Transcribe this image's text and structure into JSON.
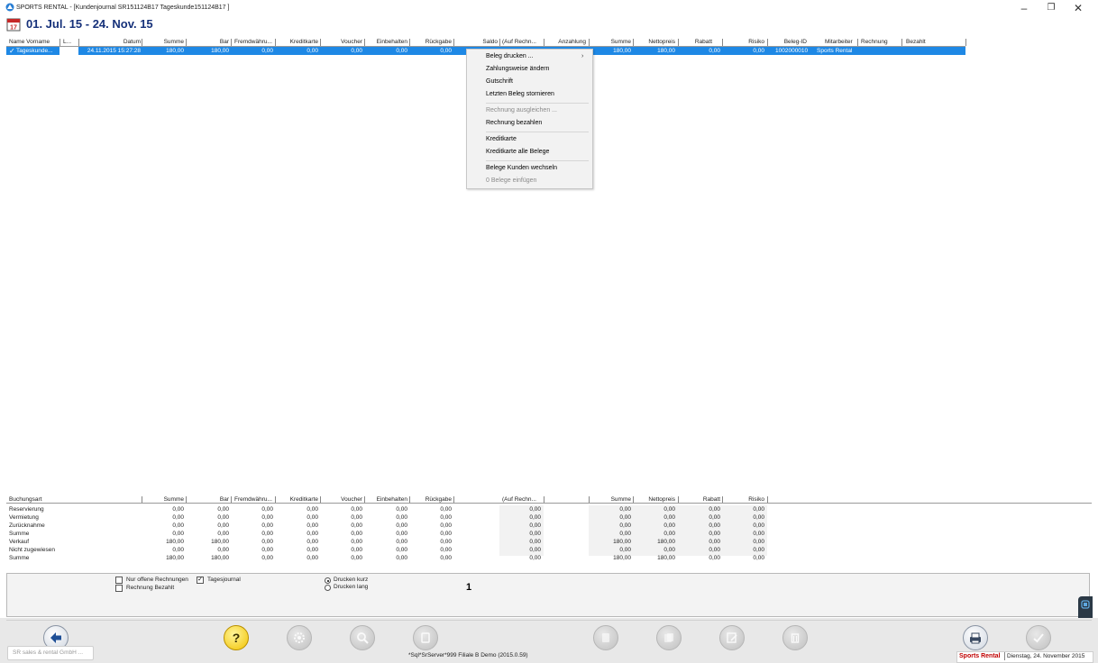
{
  "window": {
    "title": "SPORTS RENTAL - [Kundenjournal  SR151124B17 Tageskunde151124B17 ]",
    "min_glyph": "–",
    "max_glyph": "❐",
    "close_glyph": "✕"
  },
  "header": {
    "date_range": "01. Jul. 15 - 24. Nov. 15"
  },
  "top_table": {
    "columns": [
      "Name Vorname",
      "L...",
      "Datum",
      "Summe",
      "Bar",
      "Fremdwähru...",
      "Kreditkarte",
      "Voucher",
      "Einbehalten",
      "Rückgabe",
      "Saldo",
      "(Auf Rechn...",
      "Anzahlung",
      "Summe",
      "Nettopreis",
      "Rabatt",
      "Risiko",
      "Beleg-ID",
      "Mitarbeiter",
      "Rechnung",
      "Bezahlt"
    ],
    "row": {
      "name": "Tageskunde...",
      "datum": "24.11.2015 15:27:28",
      "summe": "180,00",
      "bar": "180,00",
      "fremd": "0,00",
      "kredit": "0,00",
      "voucher": "0,00",
      "einbehalten": "0,00",
      "rueckgabe": "0,00",
      "summe2": "180,00",
      "netto": "180,00",
      "rabatt": "0,00",
      "risiko": "0,00",
      "beleg_id": "1002000010",
      "mitarbeiter": "Sports Rental"
    }
  },
  "context_menu": {
    "items": [
      {
        "label": "Beleg drucken ...",
        "enabled": true
      },
      {
        "label": "Zahlungsweise ändern",
        "enabled": true
      },
      {
        "label": "Gutschrift",
        "enabled": true
      },
      {
        "label": "Letzten Beleg stornieren",
        "enabled": true
      },
      {
        "label": "Rechnung ausgleichen ...",
        "enabled": false
      },
      {
        "label": "Rechnung bezahlen",
        "enabled": true
      },
      {
        "label": "Kreditkarte",
        "enabled": true
      },
      {
        "label": "Kreditkarte alle Belege",
        "enabled": true
      },
      {
        "label": "Belege Kunden wechseln",
        "enabled": true
      },
      {
        "label": "0 Belege einfügen",
        "enabled": false
      }
    ],
    "submenu_arrow": "›"
  },
  "summary": {
    "columns": [
      "Buchungsart",
      "Summe",
      "Bar",
      "Fremdwähru...",
      "Kreditkarte",
      "Voucher",
      "Einbehalten",
      "Rückgabe",
      "(Auf Rechn...",
      "Summe",
      "Nettopreis",
      "Rabatt",
      "Risiko"
    ],
    "rows": [
      {
        "label": "Reservierung",
        "v": [
          "0,00",
          "0,00",
          "0,00",
          "0,00",
          "0,00",
          "0,00",
          "0,00",
          "0,00",
          "0,00",
          "0,00",
          "0,00",
          "0,00"
        ]
      },
      {
        "label": "Vermietung",
        "v": [
          "0,00",
          "0,00",
          "0,00",
          "0,00",
          "0,00",
          "0,00",
          "0,00",
          "0,00",
          "0,00",
          "0,00",
          "0,00",
          "0,00"
        ]
      },
      {
        "label": "Zurücknahme",
        "v": [
          "0,00",
          "0,00",
          "0,00",
          "0,00",
          "0,00",
          "0,00",
          "0,00",
          "0,00",
          "0,00",
          "0,00",
          "0,00",
          "0,00"
        ]
      },
      {
        "label": "Summe",
        "v": [
          "0,00",
          "0,00",
          "0,00",
          "0,00",
          "0,00",
          "0,00",
          "0,00",
          "0,00",
          "0,00",
          "0,00",
          "0,00",
          "0,00"
        ]
      },
      {
        "label": "Verkauf",
        "v": [
          "180,00",
          "180,00",
          "0,00",
          "0,00",
          "0,00",
          "0,00",
          "0,00",
          "0,00",
          "180,00",
          "180,00",
          "0,00",
          "0,00"
        ]
      },
      {
        "label": "Nicht zugewiesen",
        "v": [
          "0,00",
          "0,00",
          "0,00",
          "0,00",
          "0,00",
          "0,00",
          "0,00",
          "0,00",
          "0,00",
          "0,00",
          "0,00",
          "0,00"
        ]
      },
      {
        "label": "Summe",
        "v": [
          "180,00",
          "180,00",
          "0,00",
          "0,00",
          "0,00",
          "0,00",
          "0,00",
          "0,00",
          "180,00",
          "180,00",
          "0,00",
          "0,00"
        ]
      }
    ]
  },
  "options": {
    "nur_offene_label": "Nur offene Rechnungen",
    "nur_offene_checked": false,
    "tagesjournal_label": "Tagesjournal",
    "tagesjournal_checked": true,
    "rechnung_bezahlt_label": "Rechnung Bezahlt",
    "rechnung_bezahlt_checked": false,
    "drucken_kurz_label": "Drucken kurz",
    "drucken_lang_label": "Drucken lang",
    "print_mode": "kurz",
    "check_glyph": "✓",
    "page_number": "1"
  },
  "toolbar": {
    "company_label": "SR sales & rental GmbH ...",
    "server_info": "*Sql*SrServer*999  Filiale B Demo (2015.0.59)",
    "brand": "Sports Rental",
    "status_date": "Dienstag, 24. November 2015",
    "buttons": [
      {
        "name": "back-button",
        "icon": "arrow-left-icon",
        "enabled": true
      },
      {
        "name": "help-button",
        "icon": "question-icon",
        "enabled": true
      },
      {
        "name": "settings-button",
        "icon": "gear-icon",
        "enabled": false
      },
      {
        "name": "search-button",
        "icon": "search-icon",
        "enabled": false
      },
      {
        "name": "document-button",
        "icon": "document-icon",
        "enabled": false
      },
      {
        "name": "money-button",
        "icon": "money-icon",
        "enabled": false
      },
      {
        "name": "money2-button",
        "icon": "money-icon",
        "enabled": false
      },
      {
        "name": "edit-button",
        "icon": "edit-icon",
        "enabled": false
      },
      {
        "name": "delete-button",
        "icon": "trash-icon",
        "enabled": false
      },
      {
        "name": "print-button",
        "icon": "printer-icon",
        "enabled": true
      },
      {
        "name": "confirm-button",
        "icon": "check-icon",
        "enabled": false
      }
    ]
  },
  "colors": {
    "selection": "#1e88e5",
    "title_blue": "#16317a",
    "brand_red": "#c00000"
  }
}
